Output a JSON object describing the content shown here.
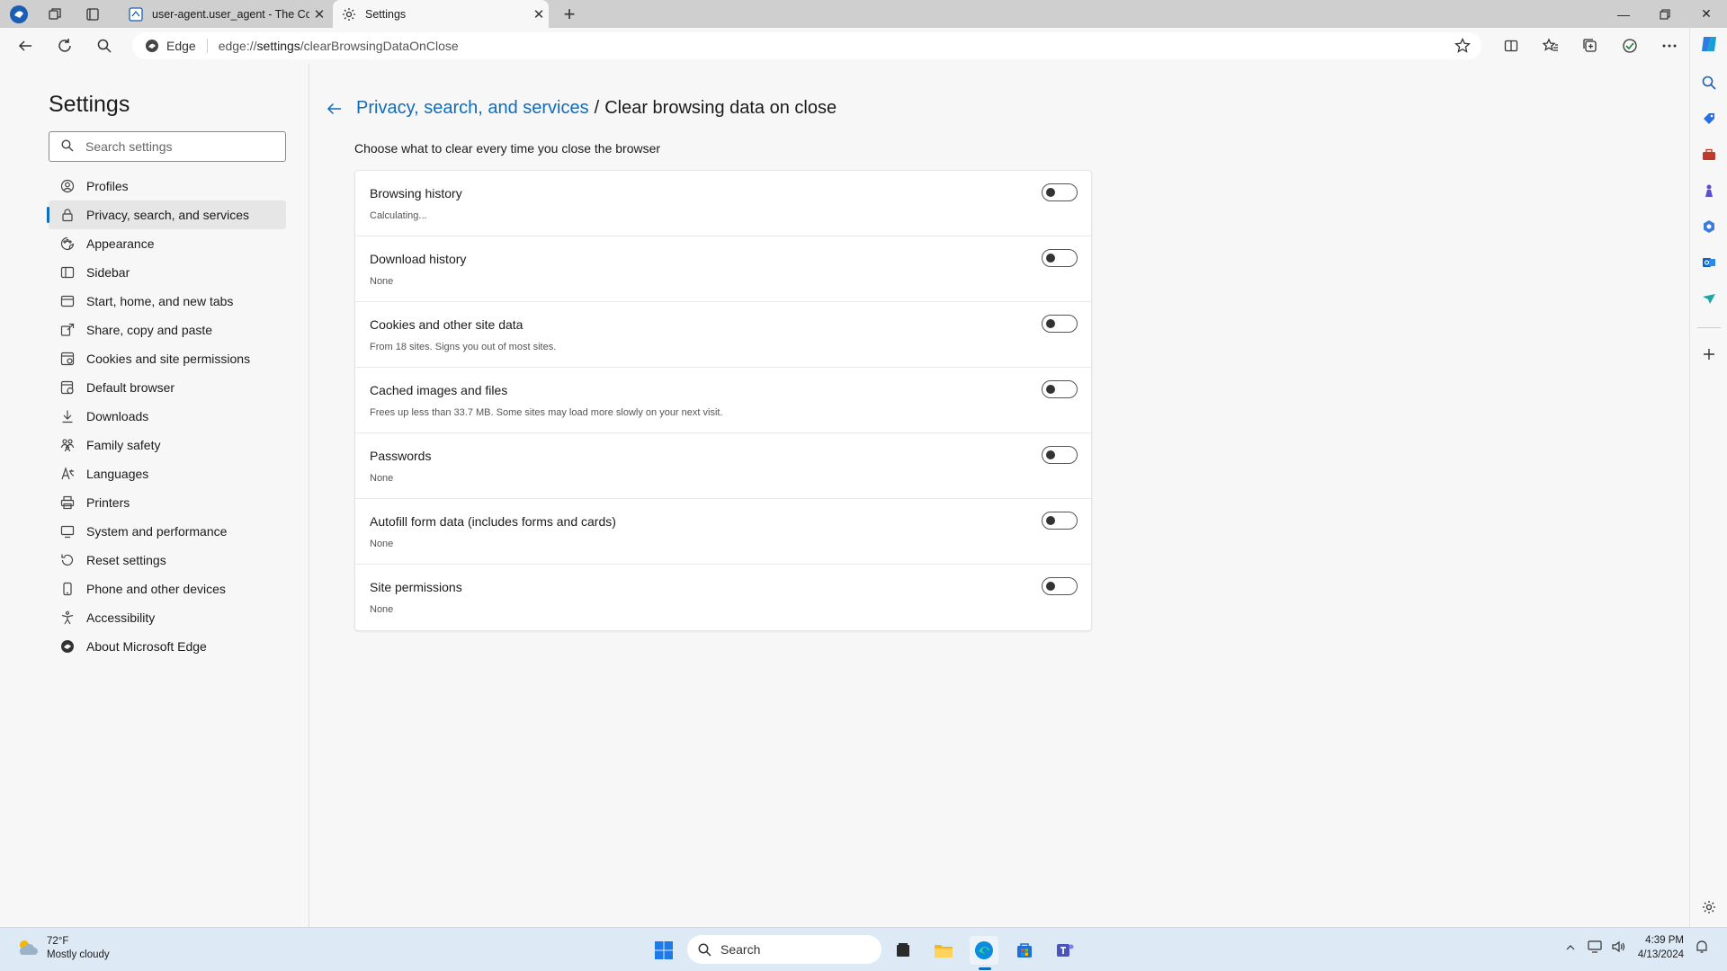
{
  "browser": {
    "tabs": [
      {
        "title": "user-agent.user_agent - The Coll",
        "active": false
      },
      {
        "title": "Settings",
        "active": true
      }
    ],
    "address": {
      "badge": "Edge",
      "url_prefix": "edge://",
      "url_strong": "settings",
      "url_rest": "/clearBrowsingDataOnClose"
    }
  },
  "settings": {
    "title": "Settings",
    "search_placeholder": "Search settings",
    "nav": [
      {
        "label": "Profiles",
        "icon": "profile-icon"
      },
      {
        "label": "Privacy, search, and services",
        "icon": "lock-icon",
        "selected": true
      },
      {
        "label": "Appearance",
        "icon": "appearance-icon"
      },
      {
        "label": "Sidebar",
        "icon": "sidebar-icon"
      },
      {
        "label": "Start, home, and new tabs",
        "icon": "home-icon"
      },
      {
        "label": "Share, copy and paste",
        "icon": "share-icon"
      },
      {
        "label": "Cookies and site permissions",
        "icon": "cookies-icon"
      },
      {
        "label": "Default browser",
        "icon": "browser-icon"
      },
      {
        "label": "Downloads",
        "icon": "download-icon"
      },
      {
        "label": "Family safety",
        "icon": "family-icon"
      },
      {
        "label": "Languages",
        "icon": "languages-icon"
      },
      {
        "label": "Printers",
        "icon": "printer-icon"
      },
      {
        "label": "System and performance",
        "icon": "system-icon"
      },
      {
        "label": "Reset settings",
        "icon": "reset-icon"
      },
      {
        "label": "Phone and other devices",
        "icon": "phone-icon"
      },
      {
        "label": "Accessibility",
        "icon": "accessibility-icon"
      },
      {
        "label": "About Microsoft Edge",
        "icon": "edge-icon"
      }
    ]
  },
  "content": {
    "breadcrumb_parent": "Privacy, search, and services",
    "breadcrumb_sep": "/",
    "breadcrumb_current": "Clear browsing data on close",
    "subtitle": "Choose what to clear every time you close the browser",
    "rows": [
      {
        "title": "Browsing history",
        "desc": "Calculating...",
        "enabled": false
      },
      {
        "title": "Download history",
        "desc": "None",
        "enabled": false
      },
      {
        "title": "Cookies and other site data",
        "desc": "From 18 sites. Signs you out of most sites.",
        "enabled": false
      },
      {
        "title": "Cached images and files",
        "desc": "Frees up less than 33.7 MB. Some sites may load more slowly on your next visit.",
        "enabled": false
      },
      {
        "title": "Passwords",
        "desc": "None",
        "enabled": false
      },
      {
        "title": "Autofill form data (includes forms and cards)",
        "desc": "None",
        "enabled": false
      },
      {
        "title": "Site permissions",
        "desc": "None",
        "enabled": false
      }
    ]
  },
  "taskbar": {
    "weather_temp": "72°F",
    "weather_desc": "Mostly cloudy",
    "search_label": "Search",
    "time": "4:39 PM",
    "date": "4/13/2024"
  },
  "colors": {
    "accent": "#0f6cbd",
    "page_bg": "#f7f7f7",
    "taskbar_bg": "#dde9f5"
  }
}
